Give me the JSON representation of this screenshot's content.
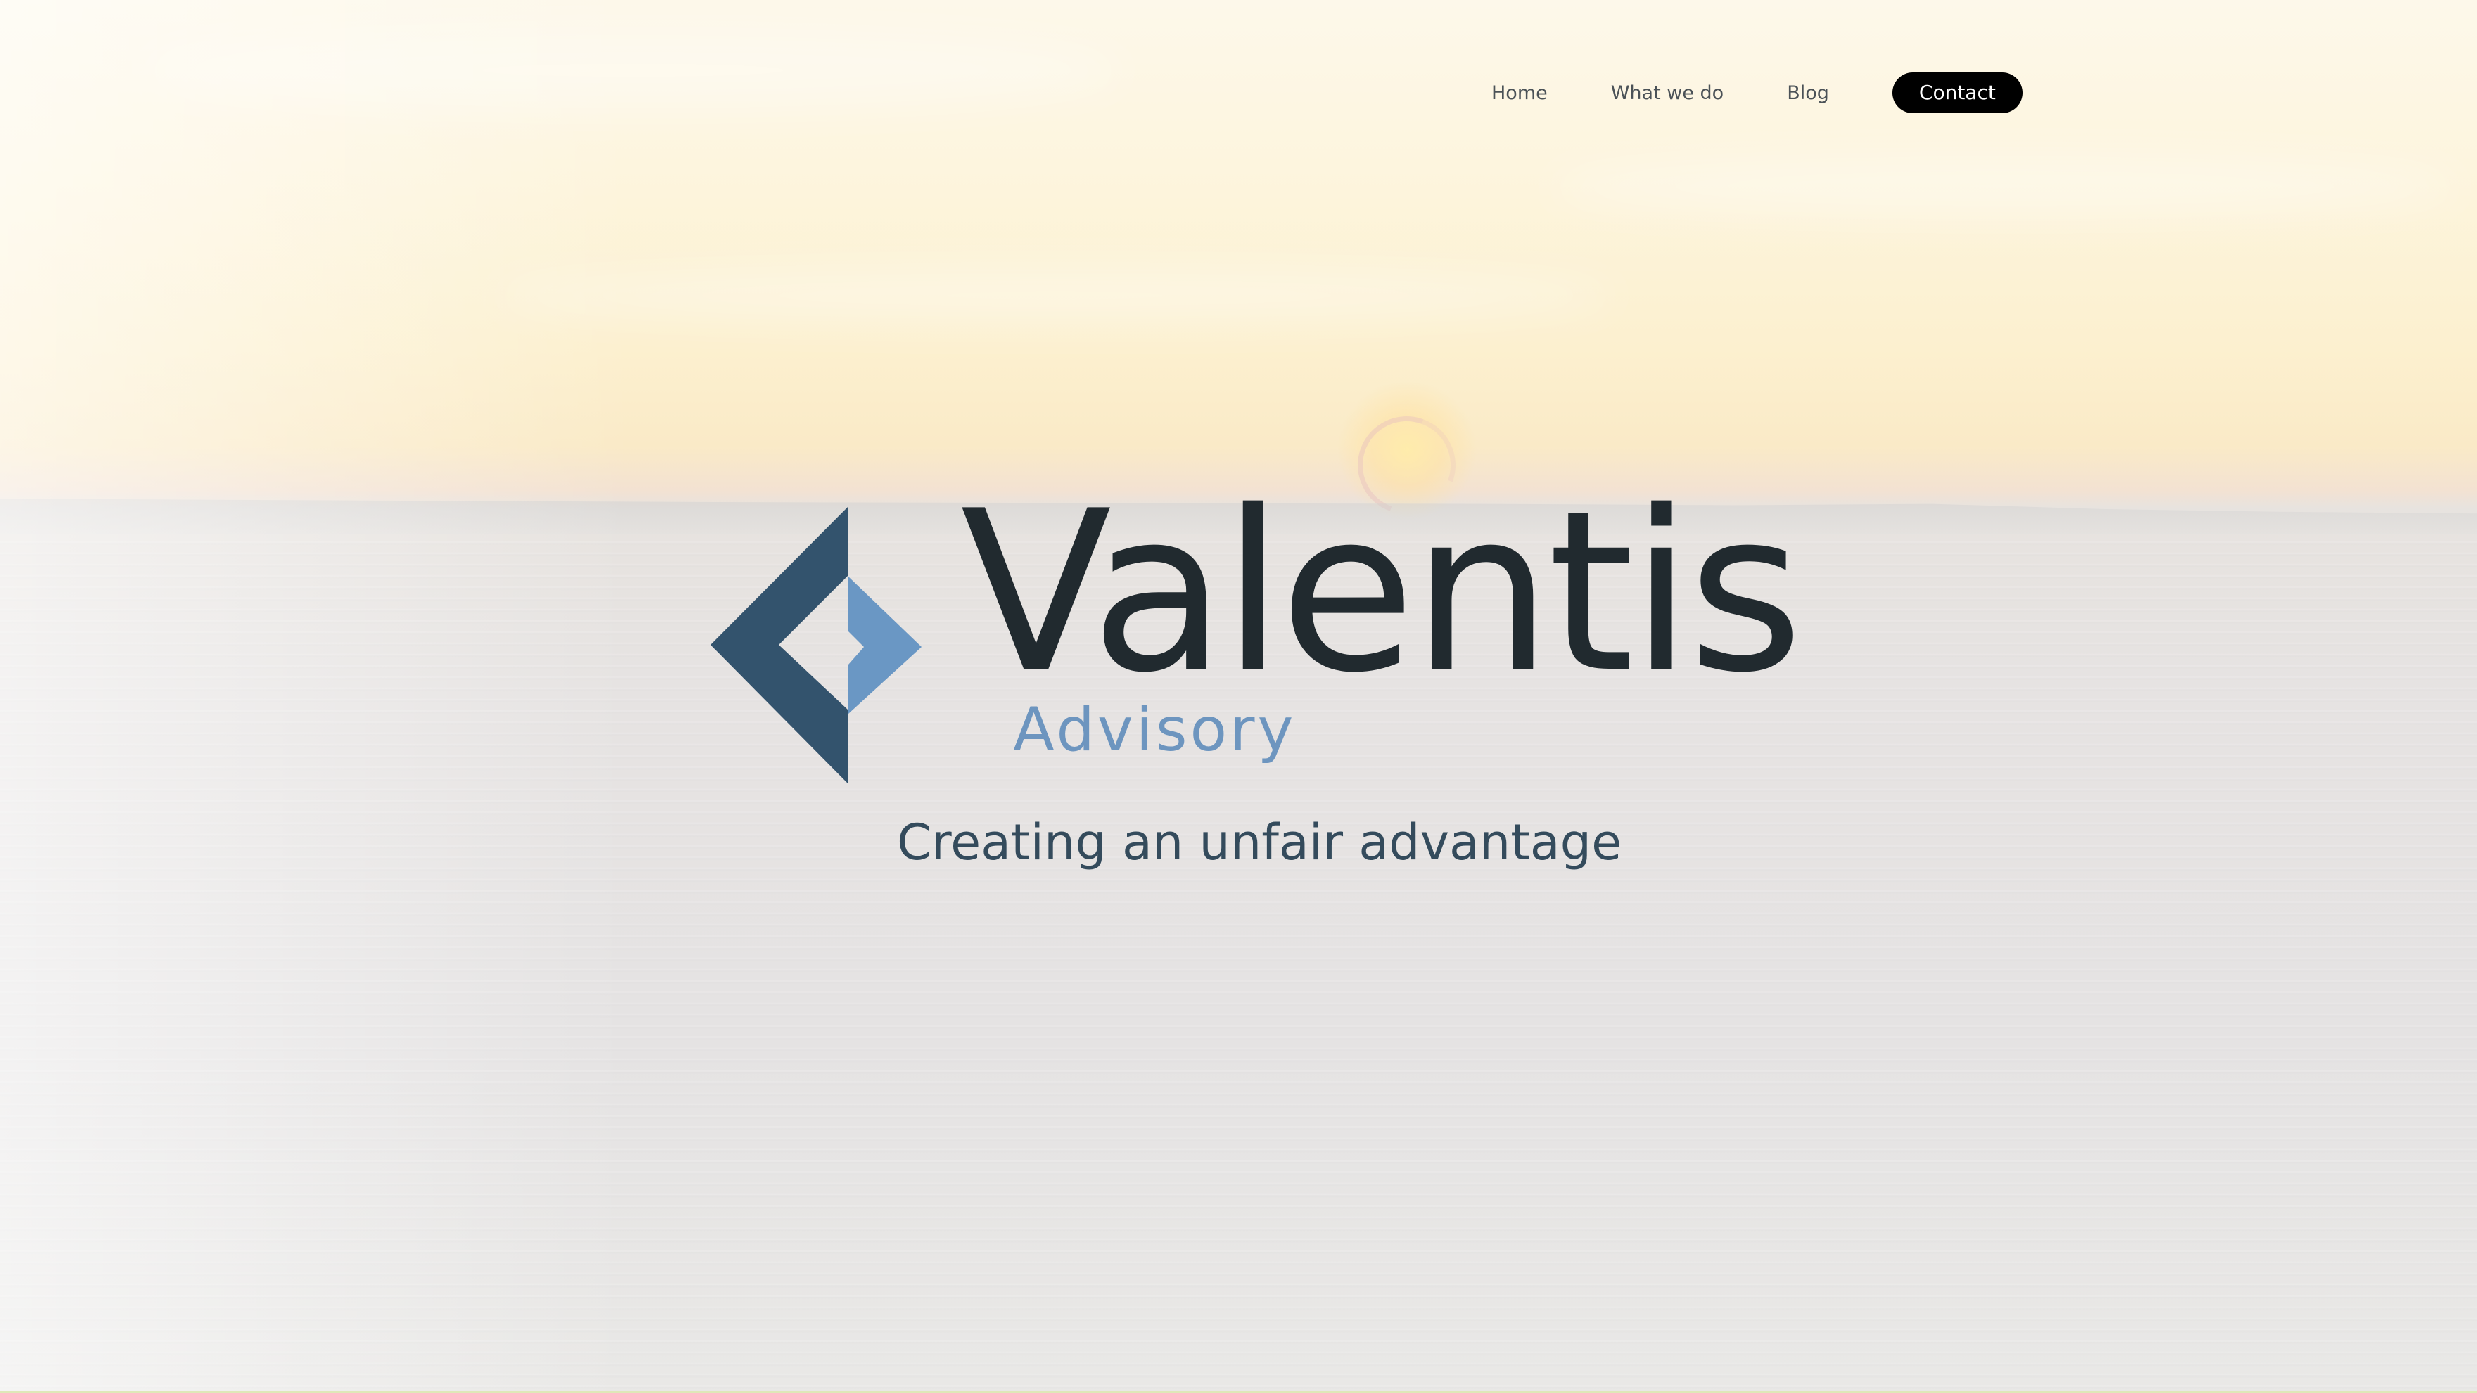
{
  "nav": {
    "items": [
      {
        "label": "Home"
      },
      {
        "label": "What we do"
      },
      {
        "label": "Blog"
      }
    ],
    "cta_label": "Contact"
  },
  "brand": {
    "name": "Valentis",
    "sub": "Advisory",
    "logo_icon": "diamond-logo-icon"
  },
  "hero": {
    "tagline": "Creating an unfair advantage"
  },
  "colors": {
    "brand_dark": "#212a2f",
    "logo_dark_blue": "#33536d",
    "logo_light_blue": "#6a97c4",
    "advisory_blue": "#6d95bf",
    "tagline": "#344b5c",
    "cta_bg": "#000000",
    "cta_text": "#ffffff"
  }
}
